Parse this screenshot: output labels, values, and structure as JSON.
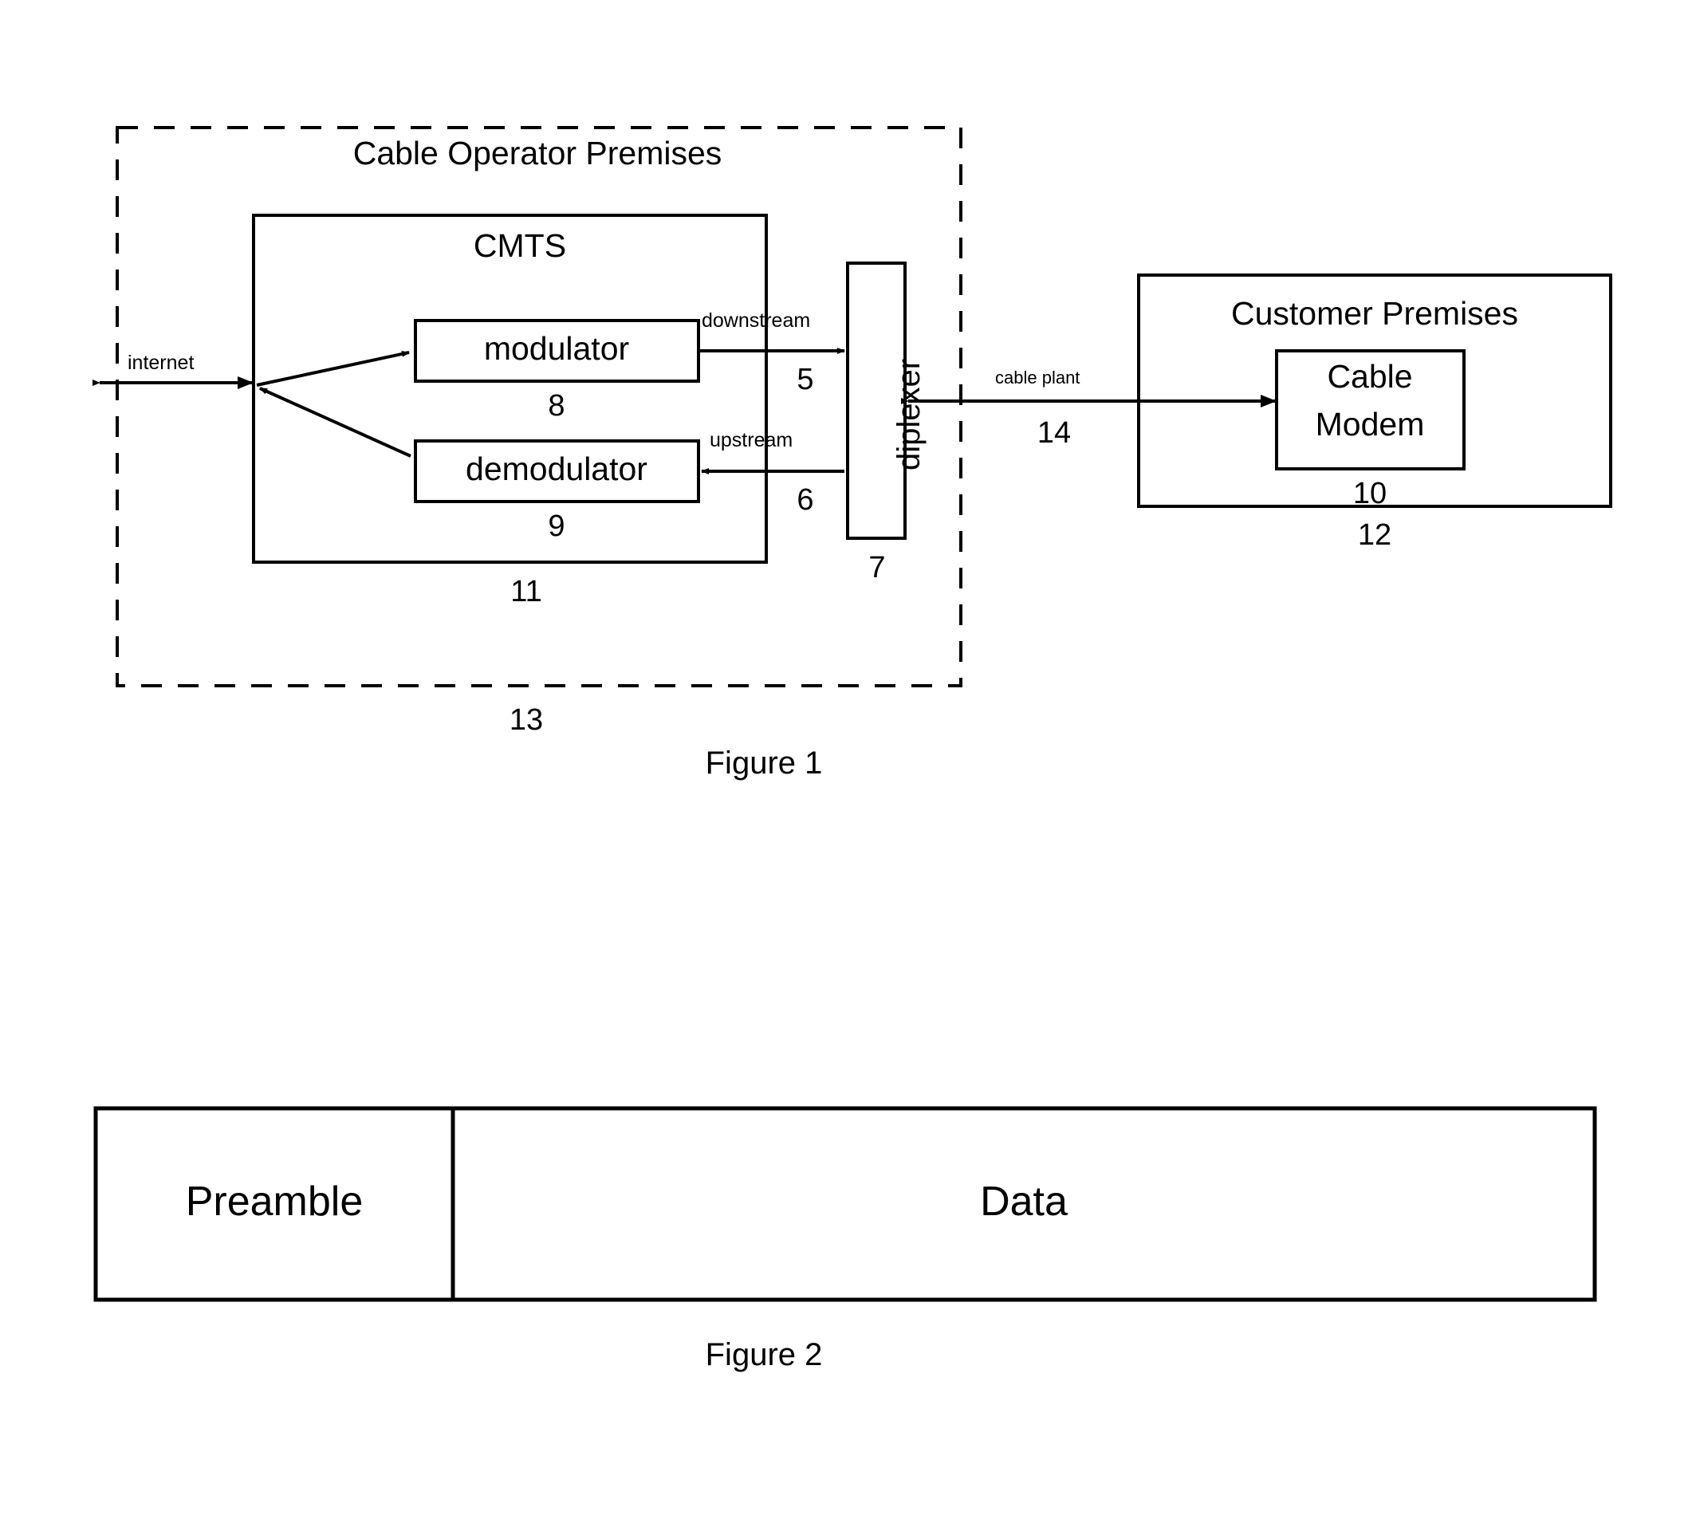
{
  "figure1": {
    "caption": "Figure 1",
    "cable_operator_premises": {
      "title": "Cable Operator Premises",
      "ref": "13"
    },
    "cmts": {
      "title": "CMTS",
      "ref": "11",
      "modulator": {
        "label": "modulator",
        "ref": "8"
      },
      "demodulator": {
        "label": "demodulator",
        "ref": "9"
      }
    },
    "diplexer": {
      "label": "diplexer",
      "ref": "7"
    },
    "customer_premises": {
      "title": "Customer Premises",
      "ref": "12",
      "cable_modem": {
        "label": "Cable Modem",
        "line1": "Cable",
        "line2": "Modem",
        "ref": "10"
      }
    },
    "links": {
      "internet": {
        "label": "internet"
      },
      "downstream": {
        "label": "downstream",
        "ref": "5"
      },
      "upstream": {
        "label": "upstream",
        "ref": "6"
      },
      "cable_plant": {
        "label": "cable plant",
        "ref": "14"
      }
    }
  },
  "figure2": {
    "caption": "Figure 2",
    "frame": {
      "fields": [
        {
          "label": "Preamble"
        },
        {
          "label": "Data"
        }
      ]
    }
  },
  "colors": {
    "ink": "#000000",
    "paper": "#ffffff"
  }
}
